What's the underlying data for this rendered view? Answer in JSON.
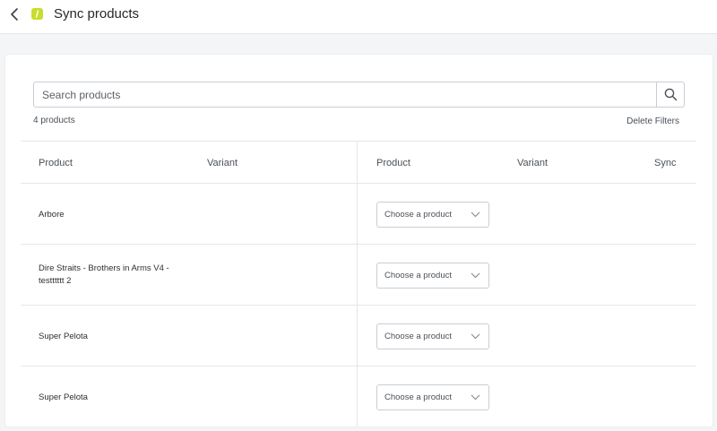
{
  "header": {
    "title": "Sync products"
  },
  "search": {
    "placeholder": "Search products"
  },
  "summary": {
    "count": "4 products",
    "delete_filters": "Delete Filters"
  },
  "columns": {
    "left_product": "Product",
    "left_variant": "Variant",
    "right_product": "Product",
    "right_variant": "Variant",
    "sync": "Sync"
  },
  "rows": [
    {
      "name": "Arbore",
      "select": "Choose a product"
    },
    {
      "name": "Dire Straits - Brothers in Arms V4 - testttttt 2",
      "select": "Choose a product"
    },
    {
      "name": "Super Pelota",
      "select": "Choose a product"
    },
    {
      "name": "Super Pelota",
      "select": "Choose a product"
    }
  ],
  "colors": {
    "logo": "#c8dd2c",
    "border": "#c9cdd2",
    "background": "#f4f5f7"
  },
  "icons": {
    "back": "chevron-left-icon",
    "search": "search-icon",
    "select": "chevron-down-icon",
    "logo": "app-logo-icon"
  }
}
